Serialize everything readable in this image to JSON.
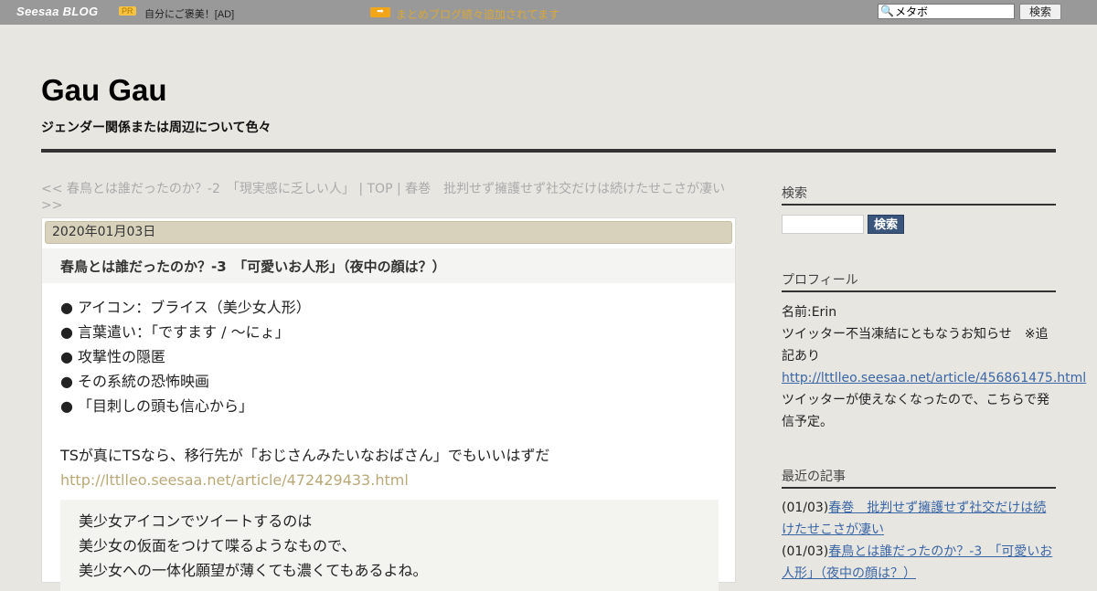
{
  "topbar": {
    "logo_main": "Seesaa",
    "logo_blog": "BLOG",
    "pr_badge": "PR",
    "ad_text": "自分にご褒美！[AD]",
    "notice_icon": "arrow-right-icon",
    "notice_text": "まとめブログ続々追加されてます",
    "search_value": "メタボ",
    "search_button": "検索"
  },
  "header": {
    "title": "Gau Gau",
    "description": "ジェンダー関係または周辺について色々"
  },
  "nav": {
    "prev": "<< 春鳥とは誰だったのか？-2　「現実感に乏しい人」",
    "sep1": " | ",
    "top": "TOP",
    "sep2": " | ",
    "next": "春巻　批判せず擁護せず社交だけは続けたせこさが凄い >>"
  },
  "article": {
    "date": "2020年01月03日",
    "title": "春鳥とは誰だったのか？-3　「可愛いお人形」（夜中の顔は？）",
    "bullets": [
      "● アイコン：ブライス（美少女人形）",
      "● 言葉遣い：「ですます / ～にょ」",
      "● 攻撃性の隠匿",
      "● その系統の恐怖映画",
      "● 「目刺しの頭も信心から」"
    ],
    "paragraph": "TSが真にTSなら、移行先が「おじさんみたいなおばさん」でもいいはずだ",
    "link": "http://lttlleo.seesaa.net/article/472429433.html",
    "quote": [
      "美少女アイコンでツイートするのは",
      "美少女の仮面をつけて喋るようなもので、",
      "美少女への一体化願望が薄くても濃くてもあるよね。"
    ]
  },
  "sidebar": {
    "search_heading": "検索",
    "search_button": "検索",
    "profile_heading": "プロフィール",
    "profile_name": "名前:Erin",
    "profile_text": "ツイッター不当凍結にともなうお知らせ　※追記あり",
    "profile_link": "http://lttlleo.seesaa.net/article/456861475.html",
    "profile_text2": "ツイッターが使えなくなったので、こちらで発信予定。",
    "recent_heading": "最近の記事",
    "recent": [
      {
        "date": "(01/03)",
        "title": "春巻　批判せず擁護せず社交だけは続けたせこさが凄い"
      },
      {
        "date": "(01/03)",
        "title": "春鳥とは誰だったのか？-3　「可愛いお人形」（夜中の顔は？）"
      }
    ]
  }
}
